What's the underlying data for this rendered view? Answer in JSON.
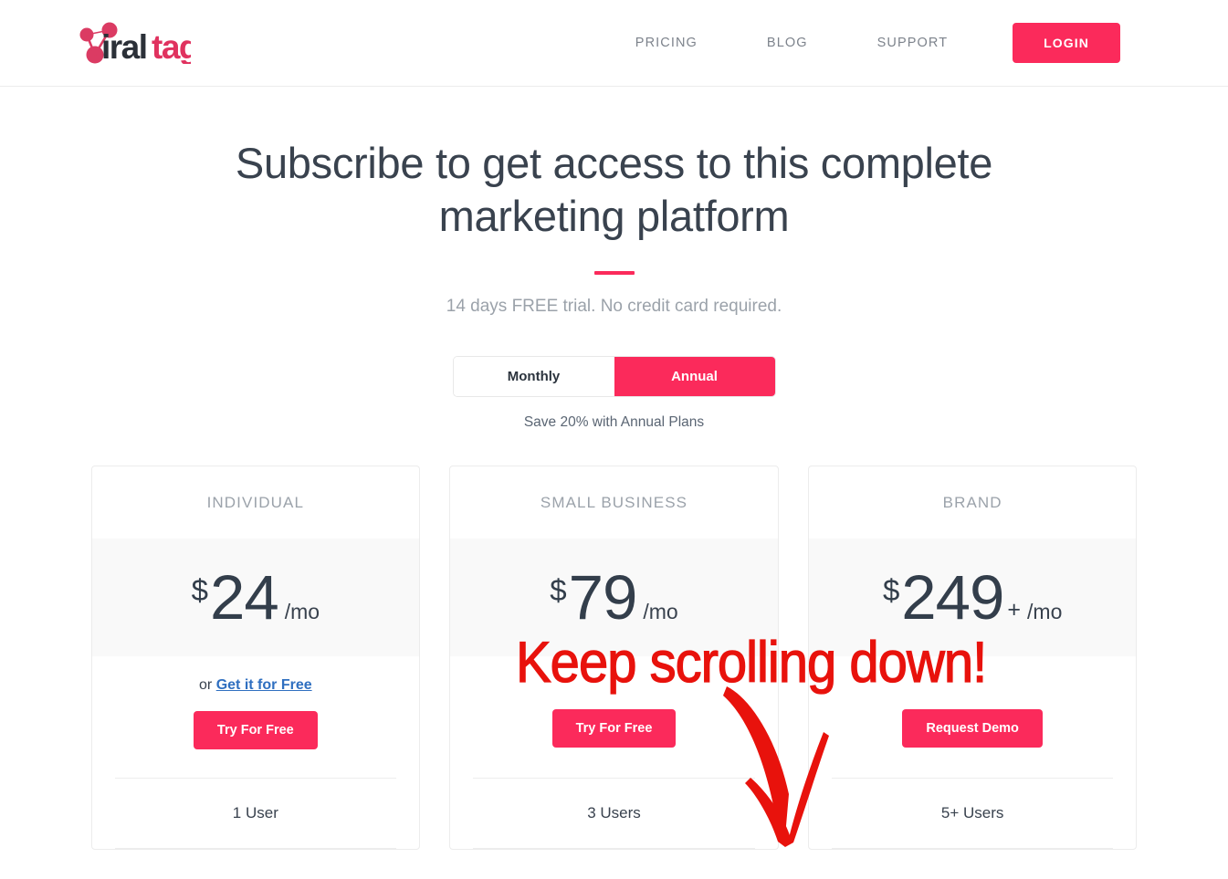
{
  "header": {
    "logo_text_dark": "viral",
    "logo_text_accent": "tag",
    "nav": [
      {
        "label": "PRICING"
      },
      {
        "label": "BLOG"
      },
      {
        "label": "SUPPORT"
      }
    ],
    "login_label": "LOGIN"
  },
  "hero": {
    "title": "Subscribe to get access to this complete marketing platform",
    "subtitle": "14 days FREE trial. No credit card required."
  },
  "billing_toggle": {
    "monthly_label": "Monthly",
    "annual_label": "Annual",
    "selected": "Annual",
    "save_note": "Save 20% with Annual Plans"
  },
  "plans": [
    {
      "name": "INDIVIDUAL",
      "currency": "$",
      "amount": "24",
      "plus": "",
      "period": "/mo",
      "free_prefix": "or ",
      "free_link": "Get it for Free",
      "cta_label": "Try For Free",
      "users": "1 User"
    },
    {
      "name": "SMALL BUSINESS",
      "currency": "$",
      "amount": "79",
      "plus": "",
      "period": "/mo",
      "free_prefix": "",
      "free_link": "",
      "cta_label": "Try For Free",
      "users": "3 Users"
    },
    {
      "name": "BRAND",
      "currency": "$",
      "amount": "249",
      "plus": "+",
      "period": "/mo",
      "free_prefix": "",
      "free_link": "",
      "cta_label": "Request Demo",
      "users": "5+ Users"
    }
  ],
  "annotation": {
    "text": "Keep scrolling down!",
    "color": "#e8120c",
    "arrow": "down-curved-arrow"
  },
  "colors": {
    "accent_pink": "#fb2a5b",
    "text_dark": "#39424e",
    "text_muted": "#9ba2aa",
    "price_bg": "#f9f9f9",
    "link_blue": "#2f6fc0",
    "annotation_red": "#e8120c"
  }
}
